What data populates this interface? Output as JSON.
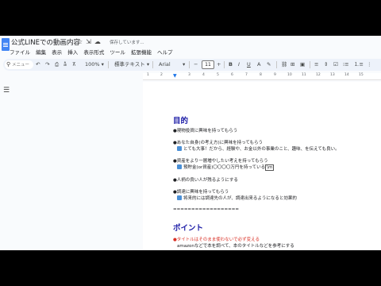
{
  "doc": {
    "title": "公式LINEでの動画内容",
    "saving": "保存しています..."
  },
  "menus": [
    "ファイル",
    "編集",
    "表示",
    "挿入",
    "表示形式",
    "ツール",
    "拡張機能",
    "ヘルプ"
  ],
  "toolbar": {
    "search_placeholder": "メニュー",
    "zoom": "100%",
    "style": "標準テキスト",
    "font": "Arial",
    "font_size": "11"
  },
  "ruler": [
    "1",
    "2",
    "3",
    "4",
    "5",
    "6",
    "7",
    "8",
    "9",
    "10",
    "11",
    "12",
    "13",
    "14",
    "15"
  ],
  "content": {
    "h1": "目的",
    "l1": "●現物投資に興味を持ってもらう",
    "l2": "●あなた自身(の考え方)に興味を持ってもらう",
    "l3": "とても大事！だから、経験や、お金以外の事業のこと、趣味、を伝えても良い。",
    "l4": "●資産をより一層増やしたい考えを持ってもらう",
    "l5_a": "預貯金(or資産)〇〇〇〇万円を持っている",
    "l5_b": "\\m",
    "l6": "●人柄の良い人が残るようにする",
    "l7": "●調達に興味を持ってもらう",
    "l8": "将来的には調達先の人が、調達出来るようになると効果的",
    "divider": "==================",
    "h2": "ポイント",
    "l9": "●タイトルはそのまま使わないで必ず変える",
    "l10": "amazonなどで本を調べて、本のタイトルなどを参考にする"
  }
}
